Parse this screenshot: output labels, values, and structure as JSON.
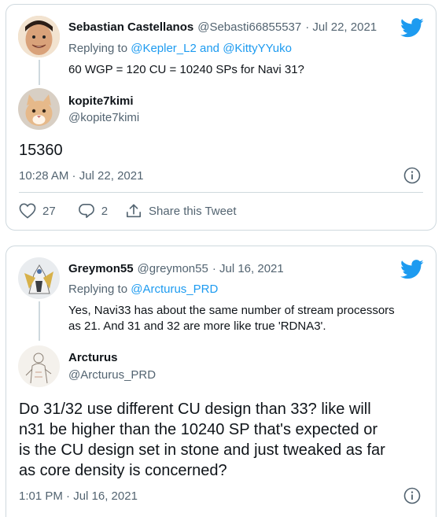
{
  "tweet1": {
    "parent": {
      "name": "Sebastian Castellanos",
      "handle": "@Sebasti66855537",
      "date": "· Jul 22, 2021",
      "replying_prefix": "Replying to",
      "replying_to": "@Kepler_L2 and @KittyYYuko",
      "text": "60 WGP = 120 CU = 10240 SPs for Navi 31?"
    },
    "reply": {
      "name": "kopite7kimi",
      "handle": "@kopite7kimi",
      "text": "15360",
      "timestamp": "10:28 AM · Jul 22, 2021"
    },
    "likes": "27",
    "replies": "2",
    "share_label": "Share this Tweet"
  },
  "tweet2": {
    "parent": {
      "name": "Greymon55",
      "handle": "@greymon55",
      "date": "· Jul 16, 2021",
      "replying_prefix": "Replying to",
      "replying_to": "@Arcturus_PRD",
      "text_line1": "Yes, Navi33 has about the same number of stream processors",
      "text_line2": "as 21. And 31 and 32 are more like true 'RDNA3'."
    },
    "reply": {
      "name": "Arcturus",
      "handle": "@Arcturus_PRD",
      "text_lines": [
        "Do 31/32 use different CU design than 33? like will",
        "n31 be higher than the 10240 SP that's expected or",
        "is the CU design set in stone and just tweaked as far",
        "as core density is concerned?"
      ],
      "timestamp": "1:01 PM · Jul 16, 2021"
    }
  },
  "colors": {
    "twitter_blue": "#1d9bf0",
    "text": "#0f1419",
    "muted": "#536471",
    "border": "#cfd9de"
  },
  "icons": [
    "twitter-bird-icon",
    "info-icon",
    "heart-icon",
    "reply-icon",
    "share-icon"
  ]
}
